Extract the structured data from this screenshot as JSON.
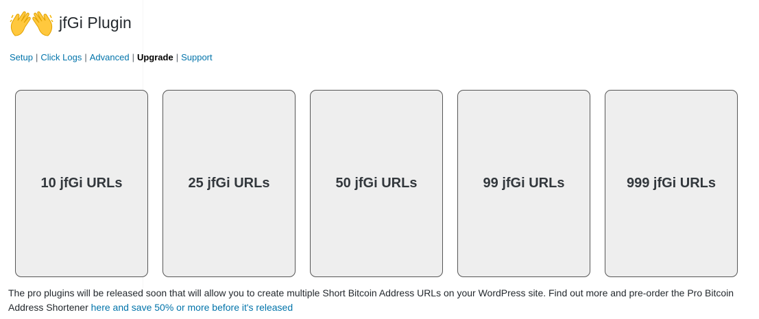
{
  "header": {
    "title": "jfGi Plugin",
    "logo_icon": "waving-hands-icon"
  },
  "nav": {
    "items": [
      {
        "label": "Setup",
        "current": false
      },
      {
        "label": "Click Logs",
        "current": false
      },
      {
        "label": "Advanced",
        "current": false
      },
      {
        "label": "Upgrade",
        "current": true
      },
      {
        "label": "Support",
        "current": false
      }
    ],
    "separator": "|"
  },
  "cards": [
    {
      "label": "10 jfGi URLs"
    },
    {
      "label": "25 jfGi URLs"
    },
    {
      "label": "50 jfGi URLs"
    },
    {
      "label": "99 jfGi URLs"
    },
    {
      "label": "999 jfGi URLs"
    }
  ],
  "description": {
    "text": "The pro plugins will be released soon that will allow you to create multiple Short Bitcoin Address URLs on your WordPress site. Find out more and pre-order the Pro Bitcoin Address Shortener ",
    "link_text": "here and save 50% or more before it's released"
  },
  "colors": {
    "link": "#0073aa",
    "card_bg": "#eeeeee",
    "card_border": "#555555",
    "text": "#23282d"
  }
}
